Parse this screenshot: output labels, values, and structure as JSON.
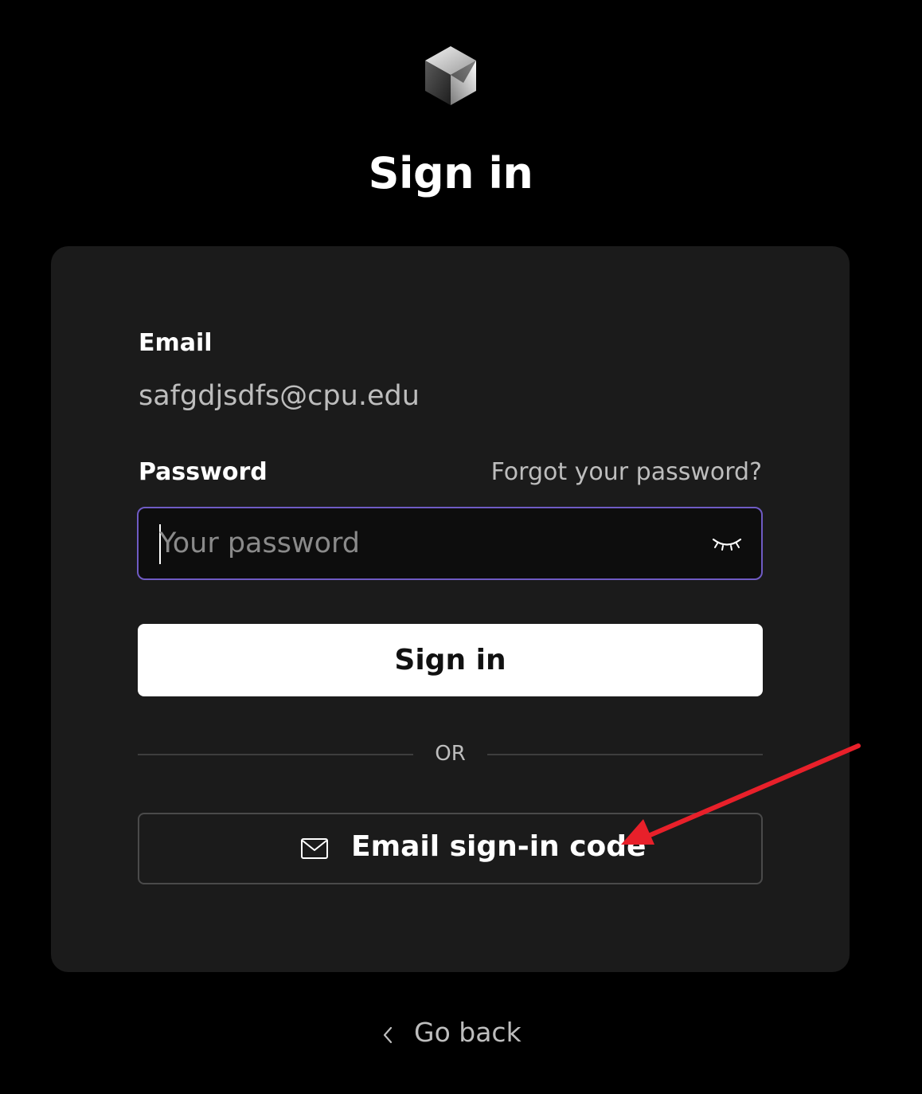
{
  "header": {
    "logo_icon": "cube-logo-icon",
    "title": "Sign in"
  },
  "form": {
    "email_label": "Email",
    "email_value": "safgdjsdfs@cpu.edu",
    "password_label": "Password",
    "forgot_password_label": "Forgot your password?",
    "password_placeholder": "Your password",
    "password_value": "",
    "show_password_icon": "eye-closed-icon",
    "signin_button_label": "Sign in",
    "divider_label": "OR",
    "email_code_icon": "mail-icon",
    "email_code_button_label": "Email sign-in code"
  },
  "footer": {
    "back_icon": "chevron-left-icon",
    "go_back_label": "Go back"
  },
  "colors": {
    "background": "#000000",
    "card": "#1b1b1b",
    "input_focus_border": "#6f5bc4",
    "primary_button": "#ffffff",
    "annotation_arrow": "#e8202a"
  }
}
